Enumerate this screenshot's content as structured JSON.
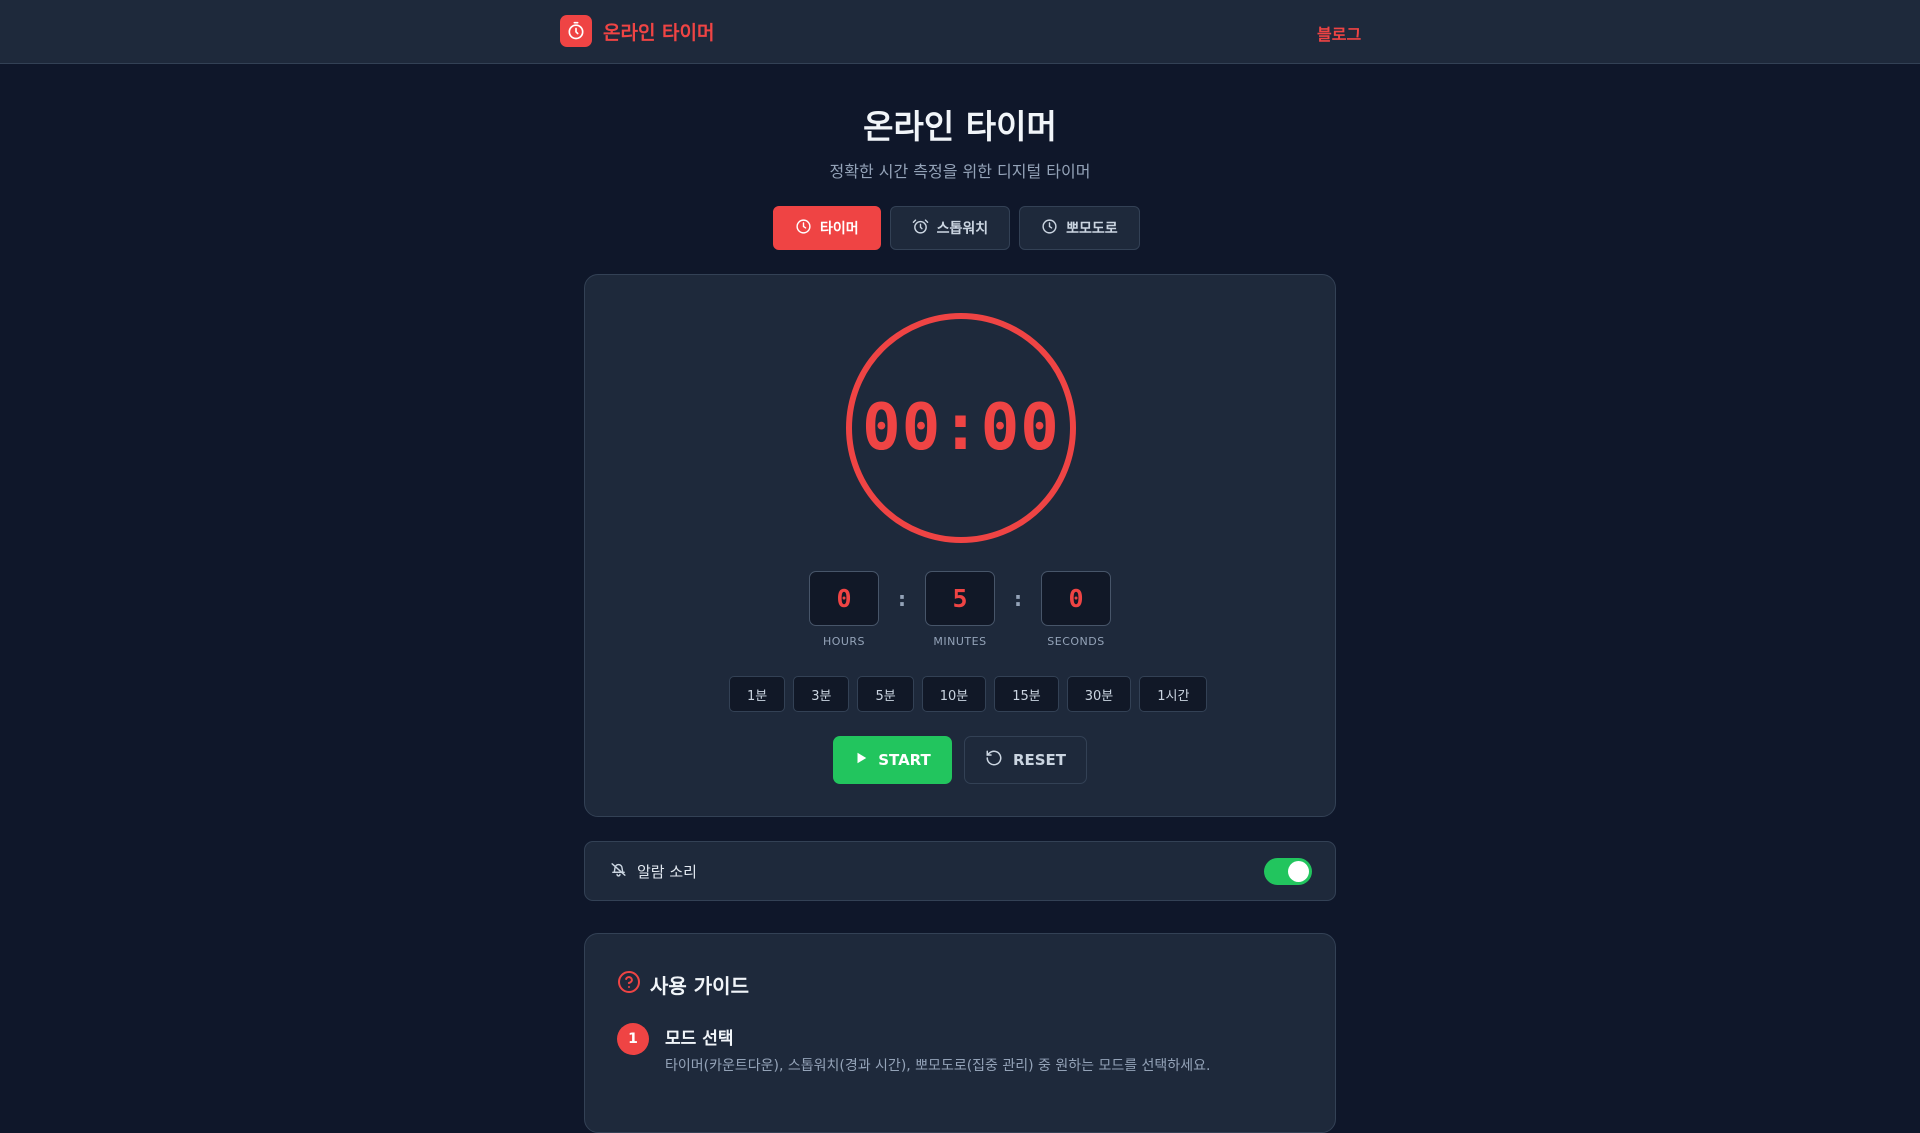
{
  "header": {
    "brand_icon": "timer-icon",
    "brand_name": "온라인 타이머",
    "blog_link": "블로그"
  },
  "hero": {
    "title": "온라인 타이머",
    "subtitle": "정확한 시간 측정을 위한 디지털 타이머"
  },
  "modes": [
    {
      "label": "타이머",
      "icon": "clock-icon",
      "active": true
    },
    {
      "label": "스톱워치",
      "icon": "alarm-clock-icon",
      "active": false
    },
    {
      "label": "뽀모도로",
      "icon": "clock-icon",
      "active": false
    }
  ],
  "timer": {
    "display": "00:00",
    "hours": "0",
    "minutes": "5",
    "seconds": "0",
    "hours_label": "HOURS",
    "minutes_label": "MINUTES",
    "seconds_label": "SECONDS",
    "separator": ":",
    "presets": [
      "1분",
      "3분",
      "5분",
      "10분",
      "15분",
      "30분",
      "1시간"
    ],
    "start_label": "START",
    "reset_label": "RESET"
  },
  "alarm": {
    "label": "알람 소리",
    "icon": "bell-off-icon",
    "enabled": true
  },
  "guide": {
    "title": "사용 가이드",
    "icon": "help-circle-icon",
    "steps": [
      {
        "number": "1",
        "title": "모드 선택",
        "description": "타이머(카운트다운), 스톱워치(경과 시간), 뽀모도로(집중 관리) 중 원하는 모드를 선택하세요."
      }
    ]
  },
  "colors": {
    "accent": "#ef4444",
    "start": "#22c55e",
    "background": "#0f172a",
    "card": "#1e293b"
  }
}
